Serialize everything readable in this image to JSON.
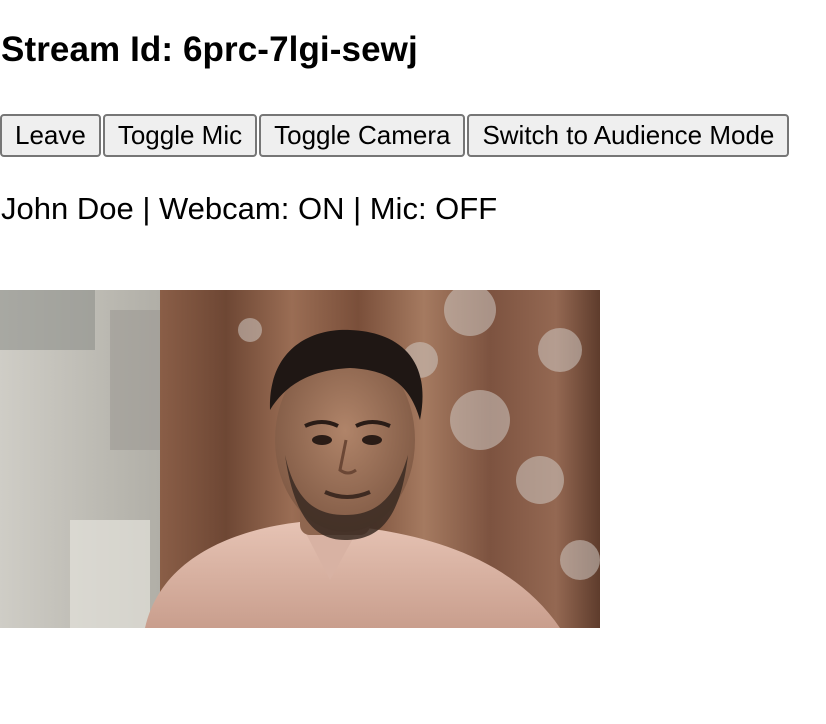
{
  "stream": {
    "title": "Stream Id: 6prc-7lgi-sewj"
  },
  "controls": {
    "leave_label": "Leave",
    "toggle_mic_label": "Toggle Mic",
    "toggle_camera_label": "Toggle Camera",
    "switch_mode_label": "Switch to Audience Mode"
  },
  "participant": {
    "status_line": "John Doe | Webcam: ON | Mic: OFF"
  },
  "video": {
    "content": "webcam-feed"
  }
}
